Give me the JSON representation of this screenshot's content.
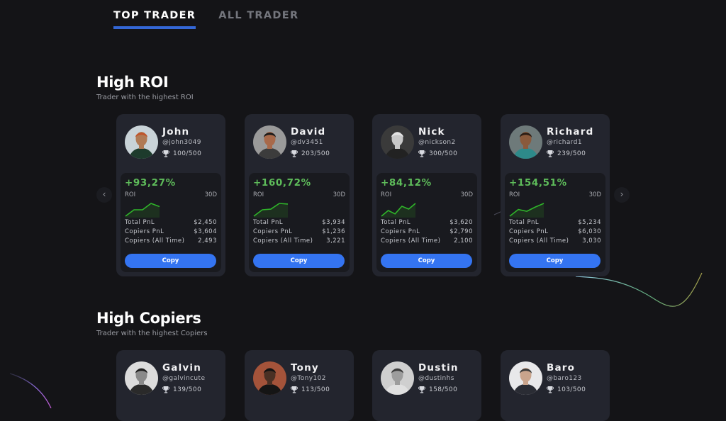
{
  "tabs": [
    {
      "label": "TOP TRADER",
      "active": true
    },
    {
      "label": "ALL TRADER",
      "active": false
    }
  ],
  "sections": {
    "high_roi": {
      "title": "High ROI",
      "subtitle": "Trader with the highest ROI",
      "prev_icon": "chevron-left-icon",
      "next_icon": "chevron-right-icon",
      "prev_glyph": "‹",
      "next_glyph": "›",
      "traders": [
        {
          "name": "John",
          "handle": "@john3049",
          "rank": "100/500",
          "roi": "+93,27%",
          "roi_label": "ROI",
          "period": "30D",
          "sparkline": [
            1,
            3,
            3,
            5,
            4
          ],
          "total_pnl_label": "Total PnL",
          "total_pnl": "$2,450",
          "copiers_pnl_label": "Copiers PnL",
          "copiers_pnl": "$3,604",
          "copiers_all_label": "Copiers (All Time)",
          "copiers_all": "2,493",
          "copy_label": "Copy",
          "avatar_colors": {
            "bg": "#c9d3d8",
            "skin": "#b07a55",
            "shirt": "#1d3b2c",
            "hair": "#c0542a"
          }
        },
        {
          "name": "David",
          "handle": "@dv3451",
          "rank": "203/500",
          "roi": "+160,72%",
          "roi_label": "ROI",
          "period": "30D",
          "sparkline": [
            1,
            3,
            3.2,
            5,
            4.8
          ],
          "total_pnl_label": "Total PnL",
          "total_pnl": "$3,934",
          "copiers_pnl_label": "Copiers PnL",
          "copiers_pnl": "$1,236",
          "copiers_all_label": "Copiers (All Time)",
          "copiers_all": "3,221",
          "copy_label": "Copy",
          "avatar_colors": {
            "bg": "#9a9a9a",
            "skin": "#a8694a",
            "shirt": "#3c3c3c",
            "hair": "#1a1a1a"
          }
        },
        {
          "name": "Nick",
          "handle": "@nickson2",
          "rank": "300/500",
          "roi": "+84,12%",
          "roi_label": "ROI",
          "period": "30D",
          "sparkline": [
            1,
            3,
            1.8,
            4.5,
            3.5,
            5.5
          ],
          "total_pnl_label": "Total PnL",
          "total_pnl": "$3,620",
          "copiers_pnl_label": "Copiers PnL",
          "copiers_pnl": "$2,790",
          "copiers_all_label": "Copiers (All Time)",
          "copiers_all": "2,100",
          "copy_label": "Copy",
          "avatar_colors": {
            "bg": "#3a3a3a",
            "skin": "#c8c8c8",
            "shirt": "#222222",
            "hair": "#e5e5e5"
          }
        },
        {
          "name": "Richard",
          "handle": "@richard1",
          "rank": "239/500",
          "roi": "+154,51%",
          "roi_label": "ROI",
          "period": "30D",
          "sparkline": [
            1,
            3.2,
            2.6,
            4,
            5.2
          ],
          "total_pnl_label": "Total PnL",
          "total_pnl": "$5,234",
          "copiers_pnl_label": "Copiers PnL",
          "copiers_pnl": "$6,030",
          "copiers_all_label": "Copiers (All Time)",
          "copiers_all": "3,030",
          "copy_label": "Copy",
          "avatar_colors": {
            "bg": "#6e7a7a",
            "skin": "#8a5a3c",
            "shirt": "#2e8a8a",
            "hair": "#2a1c14"
          }
        }
      ]
    },
    "high_copiers": {
      "title": "High Copiers",
      "subtitle": "Trader with the highest Copiers",
      "traders": [
        {
          "name": "Galvin",
          "handle": "@galvincute",
          "rank": "139/500",
          "avatar_colors": {
            "bg": "#dcdcdc",
            "skin": "#8a8a8a",
            "shirt": "#2a2a2a",
            "hair": "#1c1c1c"
          }
        },
        {
          "name": "Tony",
          "handle": "@Tony102",
          "rank": "113/500",
          "avatar_colors": {
            "bg": "#a4533a",
            "skin": "#4a3024",
            "shirt": "#151515",
            "hair": "#111111"
          }
        },
        {
          "name": "Dustin",
          "handle": "@dustinhs",
          "rank": "158/500",
          "avatar_colors": {
            "bg": "#cfcfcf",
            "skin": "#9d9d9d",
            "shirt": "#e0e0e0",
            "hair": "#3a3a3a"
          }
        },
        {
          "name": "Baro",
          "handle": "@baro123",
          "rank": "103/500",
          "avatar_colors": {
            "bg": "#e8e8ea",
            "skin": "#c9a48c",
            "shirt": "#2a2c34",
            "hair": "#3a3a3a"
          }
        }
      ]
    }
  },
  "colors": {
    "accent": "#3474f1",
    "tab_underline": "#3467d6",
    "positive": "#5ebc5a",
    "card_bg": "#23252e",
    "stats_bg": "#191a1f",
    "page_bg": "#141417"
  }
}
